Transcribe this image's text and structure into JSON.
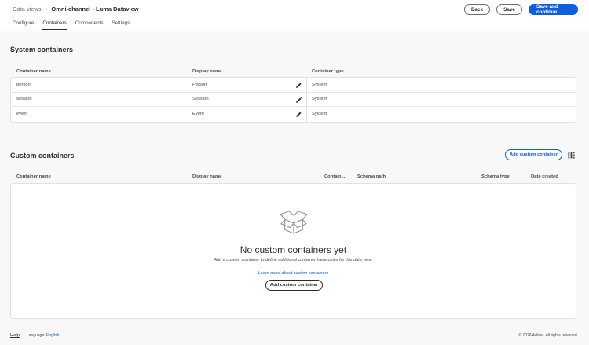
{
  "header": {
    "breadcrumb_root": "Data views",
    "breadcrumb_current": "Omni-channel - Luma Dataview",
    "tabs": [
      {
        "label": "Configure",
        "active": false
      },
      {
        "label": "Containers",
        "active": true
      },
      {
        "label": "Components",
        "active": false
      },
      {
        "label": "Settings",
        "active": false
      }
    ],
    "back_label": "Back",
    "save_label": "Save",
    "save_continue_label": "Save and continue"
  },
  "system": {
    "title": "System containers",
    "columns": [
      "Container name",
      "Display name",
      "Container type"
    ],
    "rows": [
      {
        "name": "person",
        "display": "Person",
        "type": "System"
      },
      {
        "name": "session",
        "display": "Session",
        "type": "System"
      },
      {
        "name": "event",
        "display": "Event",
        "type": "System"
      }
    ]
  },
  "custom": {
    "title": "Custom containers",
    "add_button": "Add custom container",
    "columns": [
      "Container name",
      "Display name",
      "Contain...",
      "Schema path",
      "Schema type",
      "Date created"
    ],
    "empty_title": "No custom containers yet",
    "empty_subtitle": "Add a custom container to define additional container hierarchies for this data view.",
    "empty_link": "Learn more about custom containers",
    "empty_button": "Add custom container"
  },
  "footer": {
    "help": "Help",
    "language_label": "Language:",
    "language_value": "English",
    "copyright": "© 2026 Adobe. All rights reserved."
  },
  "colors": {
    "accent": "#0f5fdc",
    "background": "#f8f8f8",
    "surface": "#ffffff"
  },
  "icons": [
    "chevron-right-icon",
    "pencil-icon",
    "column-settings-icon",
    "open-box-icon"
  ]
}
